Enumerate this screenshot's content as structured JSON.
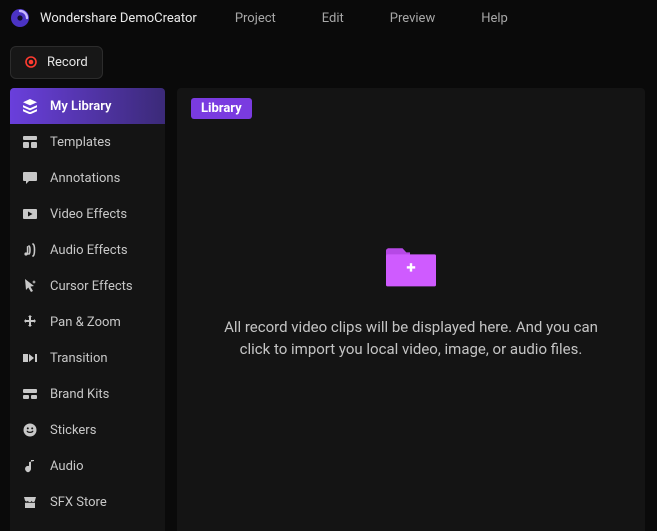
{
  "app": {
    "title": "Wondershare DemoCreator",
    "record_label": "Record"
  },
  "menubar": {
    "items": [
      "Project",
      "Edit",
      "Preview",
      "Help"
    ]
  },
  "sidebar": {
    "items": [
      {
        "label": "My Library",
        "active": true
      },
      {
        "label": "Templates"
      },
      {
        "label": "Annotations"
      },
      {
        "label": "Video Effects"
      },
      {
        "label": "Audio Effects"
      },
      {
        "label": "Cursor Effects"
      },
      {
        "label": "Pan & Zoom"
      },
      {
        "label": "Transition"
      },
      {
        "label": "Brand Kits"
      },
      {
        "label": "Stickers"
      },
      {
        "label": "Audio"
      },
      {
        "label": "SFX Store"
      }
    ]
  },
  "content": {
    "tab_label": "Library",
    "empty_message": "All record video clips will be displayed here. And you can click to import you local video, image, or audio files."
  }
}
